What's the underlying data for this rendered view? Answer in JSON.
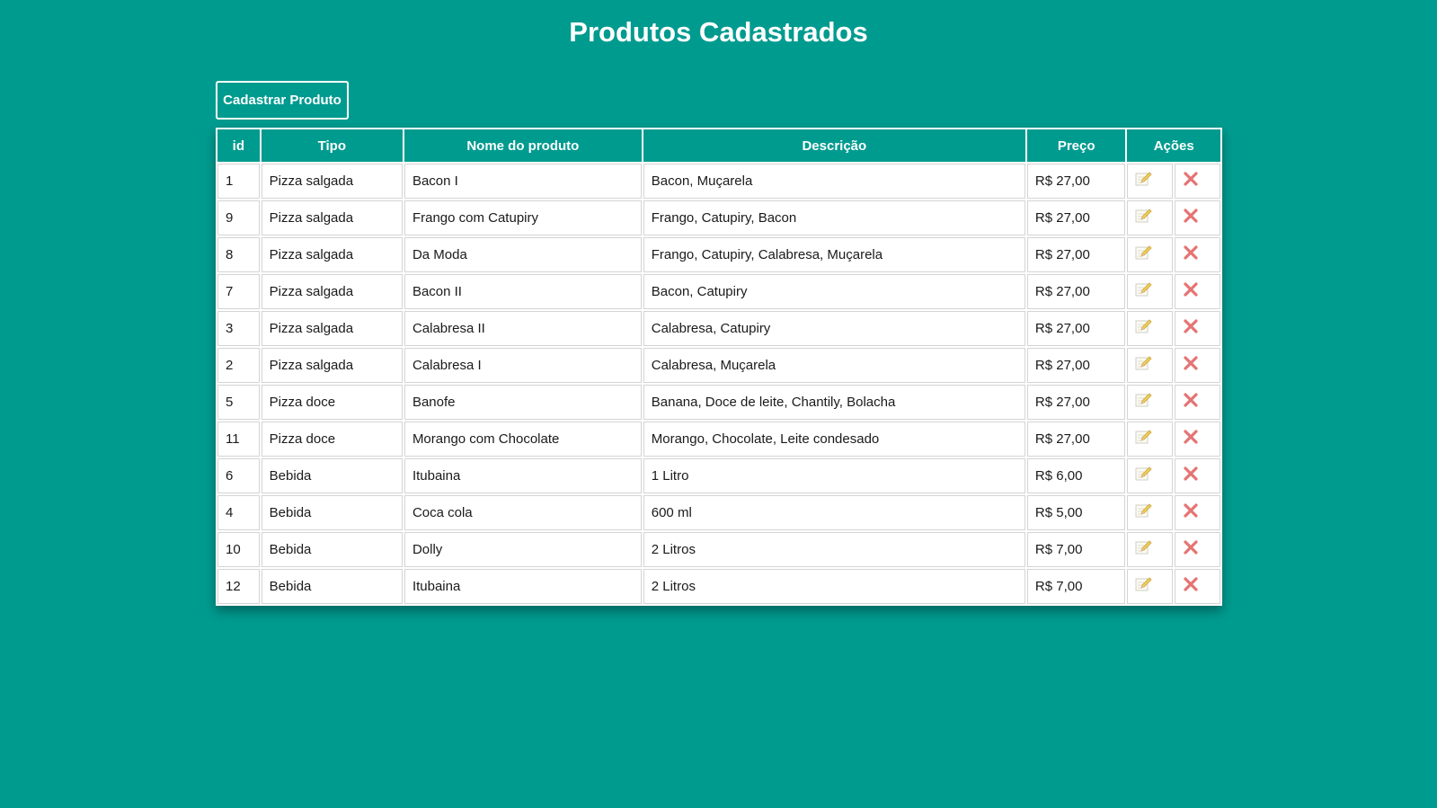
{
  "page": {
    "title": "Produtos Cadastrados",
    "add_button_label": "Cadastrar Produto"
  },
  "colors": {
    "background": "#009b8f",
    "header": "#009b8f",
    "delete": "#e57373",
    "edit": "#e8d48a"
  },
  "table": {
    "headers": {
      "id": "id",
      "tipo": "Tipo",
      "nome": "Nome do produto",
      "descricao": "Descrição",
      "preco": "Preço",
      "acoes": "Ações"
    },
    "rows": [
      {
        "id": "1",
        "tipo": "Pizza salgada",
        "nome": "Bacon I",
        "descricao": "Bacon, Muçarela",
        "preco": "R$ 27,00"
      },
      {
        "id": "9",
        "tipo": "Pizza salgada",
        "nome": "Frango com Catupiry",
        "descricao": "Frango, Catupiry, Bacon",
        "preco": "R$ 27,00"
      },
      {
        "id": "8",
        "tipo": "Pizza salgada",
        "nome": "Da Moda",
        "descricao": "Frango, Catupiry, Calabresa, Muçarela",
        "preco": "R$ 27,00"
      },
      {
        "id": "7",
        "tipo": "Pizza salgada",
        "nome": "Bacon II",
        "descricao": "Bacon, Catupiry",
        "preco": "R$ 27,00"
      },
      {
        "id": "3",
        "tipo": "Pizza salgada",
        "nome": "Calabresa II",
        "descricao": "Calabresa, Catupiry",
        "preco": "R$ 27,00"
      },
      {
        "id": "2",
        "tipo": "Pizza salgada",
        "nome": "Calabresa I",
        "descricao": "Calabresa, Muçarela",
        "preco": "R$ 27,00"
      },
      {
        "id": "5",
        "tipo": "Pizza doce",
        "nome": "Banofe",
        "descricao": "Banana, Doce de leite, Chantily, Bolacha",
        "preco": "R$ 27,00"
      },
      {
        "id": "11",
        "tipo": "Pizza doce",
        "nome": "Morango com Chocolate",
        "descricao": "Morango, Chocolate, Leite condesado",
        "preco": "R$ 27,00"
      },
      {
        "id": "6",
        "tipo": "Bebida",
        "nome": "Itubaina",
        "descricao": "1 Litro",
        "preco": "R$ 6,00"
      },
      {
        "id": "4",
        "tipo": "Bebida",
        "nome": "Coca cola",
        "descricao": "600 ml",
        "preco": "R$ 5,00"
      },
      {
        "id": "10",
        "tipo": "Bebida",
        "nome": "Dolly",
        "descricao": "2 Litros",
        "preco": "R$ 7,00"
      },
      {
        "id": "12",
        "tipo": "Bebida",
        "nome": "Itubaina",
        "descricao": "2 Litros",
        "preco": "R$ 7,00"
      }
    ],
    "row_actions": [
      "pencil-edit-icon",
      "x-delete-icon"
    ]
  }
}
